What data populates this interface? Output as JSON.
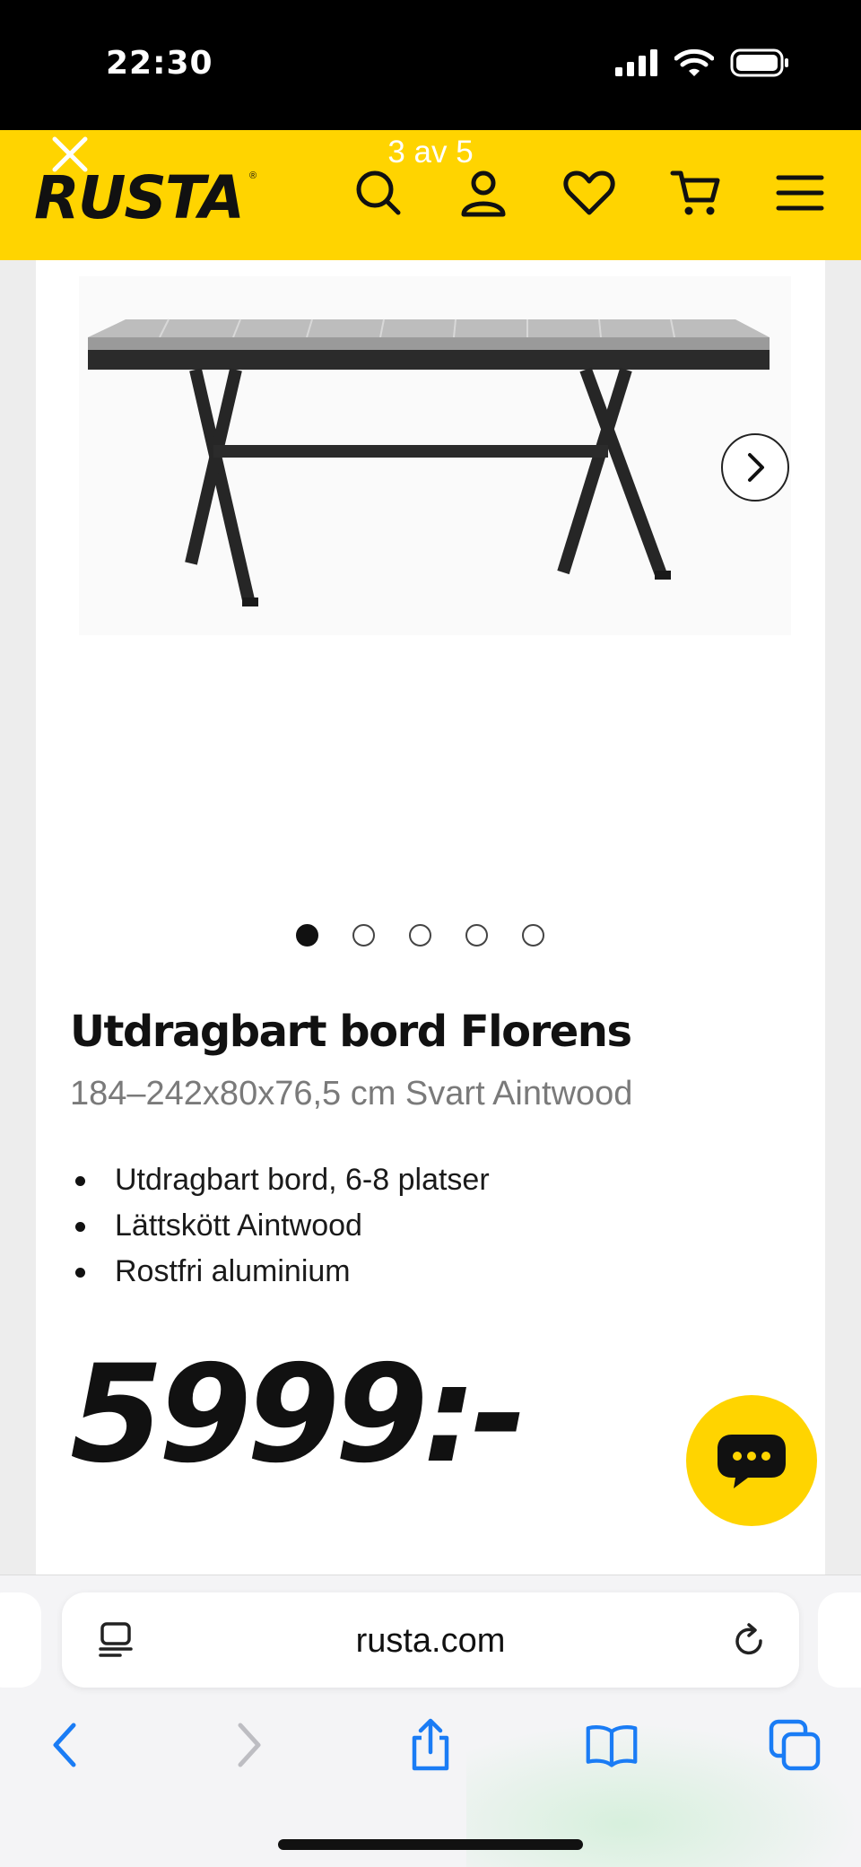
{
  "status": {
    "time": "22:30"
  },
  "header": {
    "close_icon": "close-icon",
    "counter": "3 av 5",
    "logo": "RUSTA",
    "icons": [
      "search-icon",
      "account-icon",
      "heart-icon",
      "cart-icon",
      "menu-icon"
    ]
  },
  "gallery": {
    "total": 5,
    "active": 0
  },
  "product": {
    "title": "Utdragbart bord Florens",
    "subtitle": "184–242x80x76,5 cm Svart Aintwood",
    "features": [
      "Utdragbart bord, 6-8 platser",
      "Lättskött Aintwood",
      "Rostfri aluminium"
    ],
    "price": "5999:-"
  },
  "browser": {
    "url": "rusta.com",
    "toolbar_icons": [
      "back-icon",
      "forward-icon",
      "share-icon",
      "bookmarks-icon",
      "tabs-icon"
    ]
  },
  "colors": {
    "brand_yellow": "#ffd400",
    "ios_blue": "#1a7cf5"
  }
}
